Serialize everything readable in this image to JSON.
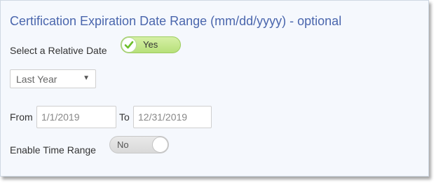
{
  "section": {
    "title": "Certification Expiration Date Range (mm/dd/yyyy) - optional"
  },
  "relative_date": {
    "label": "Select a Relative Date",
    "toggle_label": "Yes",
    "toggle_state": "on",
    "toggle_icon": "check-icon"
  },
  "range_select": {
    "selected": "Last Year",
    "icon": "caret-down-icon"
  },
  "date_range": {
    "from_label": "From",
    "from_value": "1/1/2019",
    "to_label": "To",
    "to_value": "12/31/2019"
  },
  "time_range": {
    "label": "Enable Time Range",
    "toggle_label": "No",
    "toggle_state": "off"
  },
  "colors": {
    "title": "#4a66ad",
    "toggle_on": "#b7e07a",
    "toggle_off": "#d9d9d9",
    "check": "#6cbf2a"
  }
}
